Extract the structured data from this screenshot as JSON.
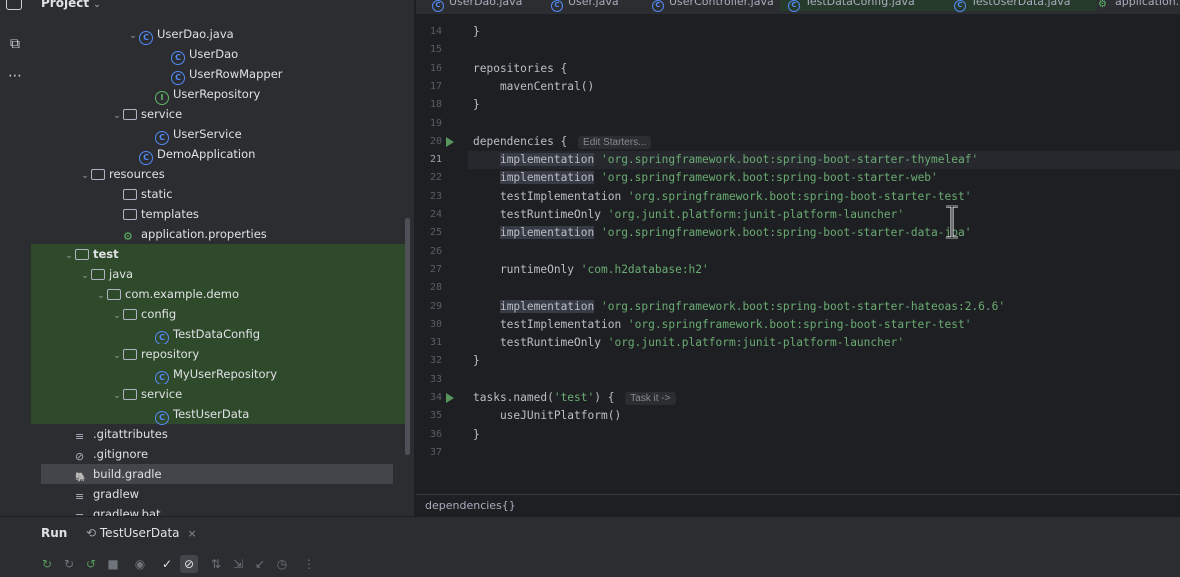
{
  "project_panel": {
    "title": "Project",
    "tree": [
      {
        "label": "UserDao.java",
        "icon": "class",
        "arrow": "down",
        "indent": 6
      },
      {
        "label": "UserDao",
        "icon": "class",
        "arrow": "",
        "indent": 8
      },
      {
        "label": "UserRowMapper",
        "icon": "class",
        "arrow": "",
        "indent": 8
      },
      {
        "label": "UserRepository",
        "icon": "interface",
        "arrow": "",
        "indent": 7
      },
      {
        "label": "service",
        "icon": "folder",
        "arrow": "down",
        "indent": 5
      },
      {
        "label": "UserService",
        "icon": "class",
        "arrow": "",
        "indent": 7
      },
      {
        "label": "DemoApplication",
        "icon": "class",
        "arrow": "",
        "indent": 6
      },
      {
        "label": "resources",
        "icon": "folder",
        "arrow": "down",
        "indent": 3
      },
      {
        "label": "static",
        "icon": "folder",
        "arrow": "",
        "indent": 5
      },
      {
        "label": "templates",
        "icon": "folder",
        "arrow": "",
        "indent": 5
      },
      {
        "label": "application.properties",
        "icon": "properties",
        "arrow": "",
        "indent": 5
      },
      {
        "label": "test",
        "icon": "folder",
        "arrow": "down",
        "indent": 2,
        "bold": true,
        "green": true
      },
      {
        "label": "java",
        "icon": "folder",
        "arrow": "down",
        "indent": 3,
        "green": true
      },
      {
        "label": "com.example.demo",
        "icon": "folder",
        "arrow": "down",
        "indent": 4,
        "green": true
      },
      {
        "label": "config",
        "icon": "folder",
        "arrow": "down",
        "indent": 5,
        "green": true
      },
      {
        "label": "TestDataConfig",
        "icon": "class",
        "arrow": "",
        "indent": 7,
        "green": true
      },
      {
        "label": "repository",
        "icon": "folder",
        "arrow": "down",
        "indent": 5,
        "green": true
      },
      {
        "label": "MyUserRepository",
        "icon": "class",
        "arrow": "",
        "indent": 7,
        "green": true
      },
      {
        "label": "service",
        "icon": "folder",
        "arrow": "down",
        "indent": 5,
        "green": true
      },
      {
        "label": "TestUserData",
        "icon": "class",
        "arrow": "",
        "indent": 7,
        "green": true
      },
      {
        "label": ".gitattributes",
        "icon": "file",
        "arrow": "",
        "indent": 2
      },
      {
        "label": ".gitignore",
        "icon": "ignore",
        "arrow": "",
        "indent": 2
      },
      {
        "label": "build.gradle",
        "icon": "gradle",
        "arrow": "",
        "indent": 2,
        "selected": true
      },
      {
        "label": "gradlew",
        "icon": "file",
        "arrow": "",
        "indent": 2
      },
      {
        "label": "gradlew.bat",
        "icon": "file",
        "arrow": "",
        "indent": 2
      }
    ]
  },
  "tabs": [
    {
      "label": "UserDao.java",
      "icon": "class"
    },
    {
      "label": "User.java",
      "icon": "class"
    },
    {
      "label": "UserController.java",
      "icon": "class"
    },
    {
      "label": "TestDataConfig.java",
      "icon": "class",
      "active": true
    },
    {
      "label": "TestUserData.java",
      "icon": "class",
      "active": true
    },
    {
      "label": "application.pr",
      "icon": "properties"
    }
  ],
  "editor": {
    "current_line": 21,
    "lines": [
      {
        "n": 14,
        "t": [
          [
            "}",
            ""
          ]
        ]
      },
      {
        "n": 15,
        "t": []
      },
      {
        "n": 16,
        "t": [
          [
            "repositories {",
            ""
          ]
        ]
      },
      {
        "n": 17,
        "t": [
          [
            "    mavenCentral()",
            ""
          ]
        ]
      },
      {
        "n": 18,
        "t": [
          [
            "}",
            ""
          ]
        ]
      },
      {
        "n": 19,
        "t": []
      },
      {
        "n": 20,
        "t": [
          [
            "dependencies { ",
            ""
          ]
        ],
        "hint": "Edit Starters...",
        "run": true
      },
      {
        "n": 21,
        "t": [
          [
            "    ",
            ""
          ],
          [
            "implementation",
            "hl"
          ],
          [
            " ",
            ""
          ],
          [
            "'org.springframework.boot:spring-boot-starter-thymeleaf'",
            "str"
          ]
        ]
      },
      {
        "n": 22,
        "t": [
          [
            "    ",
            ""
          ],
          [
            "implementation",
            "hl"
          ],
          [
            " ",
            ""
          ],
          [
            "'org.springframework.boot:spring-boot-starter-web'",
            "str"
          ]
        ]
      },
      {
        "n": 23,
        "t": [
          [
            "    testImplementation ",
            ""
          ],
          [
            "'org.springframework.boot:spring-boot-starter-test'",
            "str"
          ]
        ]
      },
      {
        "n": 24,
        "t": [
          [
            "    testRuntimeOnly ",
            ""
          ],
          [
            "'org.junit.platform:junit-platform-launcher'",
            "str"
          ]
        ]
      },
      {
        "n": 25,
        "t": [
          [
            "    ",
            ""
          ],
          [
            "implementation",
            "hl"
          ],
          [
            " ",
            ""
          ],
          [
            "'org.springframework.boot:spring-boot-starter-data-jpa'",
            "str"
          ]
        ]
      },
      {
        "n": 26,
        "t": []
      },
      {
        "n": 27,
        "t": [
          [
            "    runtimeOnly ",
            ""
          ],
          [
            "'com.h2database:h2'",
            "str"
          ]
        ]
      },
      {
        "n": 28,
        "t": []
      },
      {
        "n": 29,
        "t": [
          [
            "    ",
            ""
          ],
          [
            "implementation",
            "hl"
          ],
          [
            " ",
            ""
          ],
          [
            "'org.springframework.boot:spring-boot-starter-hateoas:2.6.6'",
            "str"
          ]
        ]
      },
      {
        "n": 30,
        "t": [
          [
            "    testImplementation ",
            ""
          ],
          [
            "'org.springframework.boot:spring-boot-starter-test'",
            "str"
          ]
        ]
      },
      {
        "n": 31,
        "t": [
          [
            "    testRuntimeOnly ",
            ""
          ],
          [
            "'org.junit.platform:junit-platform-launcher'",
            "str"
          ]
        ]
      },
      {
        "n": 32,
        "t": [
          [
            "}",
            ""
          ]
        ]
      },
      {
        "n": 33,
        "t": []
      },
      {
        "n": 34,
        "t": [
          [
            "tasks.named(",
            ""
          ],
          [
            "'test'",
            "str"
          ],
          [
            ") { ",
            ""
          ]
        ],
        "hint": "Task it ->",
        "run": true
      },
      {
        "n": 35,
        "t": [
          [
            "    useJUnitPlatform()",
            ""
          ]
        ]
      },
      {
        "n": 36,
        "t": [
          [
            "}",
            ""
          ]
        ]
      },
      {
        "n": 37,
        "t": []
      }
    ]
  },
  "breadcrumb": "dependencies{}",
  "run_panel": {
    "title": "Run",
    "tab_label": "TestUserData",
    "close": "×"
  },
  "colors": {
    "accent_green": "#57965c",
    "string": "#6aab73",
    "class_icon": "#548af7"
  }
}
